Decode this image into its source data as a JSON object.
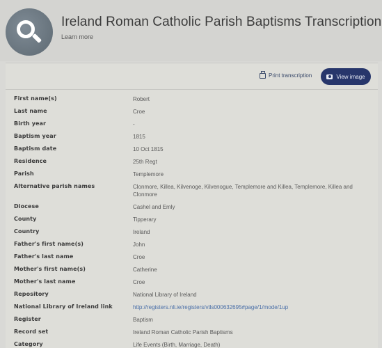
{
  "header": {
    "title": "Ireland Roman Catholic Parish Baptisms Transcription",
    "learn_more": "Learn more",
    "logo_icon": "search-icon"
  },
  "toolbar": {
    "print_label": "Print transcription",
    "view_label": "View image"
  },
  "rows": [
    {
      "label": "First name(s)",
      "value": "Robert"
    },
    {
      "label": "Last name",
      "value": "Croe"
    },
    {
      "label": "Birth year",
      "value": "-"
    },
    {
      "label": "Baptism year",
      "value": "1815"
    },
    {
      "label": "Baptism date",
      "value": "10 Oct 1815"
    },
    {
      "label": "Residence",
      "value": "25th Regt"
    },
    {
      "label": "Parish",
      "value": "Templemore"
    },
    {
      "label": "Alternative parish names",
      "value": "Clonmore, Killea, Kilvenoge, Kilvenogue, Templemore and Killea, Templemore, Killea and Clonmore"
    },
    {
      "label": "Diocese",
      "value": "Cashel and Emly"
    },
    {
      "label": "County",
      "value": "Tipperary"
    },
    {
      "label": "Country",
      "value": "Ireland"
    },
    {
      "label": "Father's first name(s)",
      "value": "John"
    },
    {
      "label": "Father's last name",
      "value": "Croe"
    },
    {
      "label": "Mother's first name(s)",
      "value": "Catherine"
    },
    {
      "label": "Mother's last name",
      "value": "Croe"
    },
    {
      "label": "Repository",
      "value": "National Library of Ireland"
    },
    {
      "label": "National Library of Ireland link",
      "value": "http://registers.nli.ie/registers/vtls000632695#page/1/mode/1up"
    },
    {
      "label": "Register",
      "value": "Baptism"
    },
    {
      "label": "Record set",
      "value": "Ireland Roman Catholic Parish Baptisms"
    },
    {
      "label": "Category",
      "value": "Life Events (Birth, Marriage, Death)"
    }
  ],
  "colors": {
    "accent": "#27366b",
    "link": "#4a6fa8",
    "background": "#d9d9d6"
  }
}
